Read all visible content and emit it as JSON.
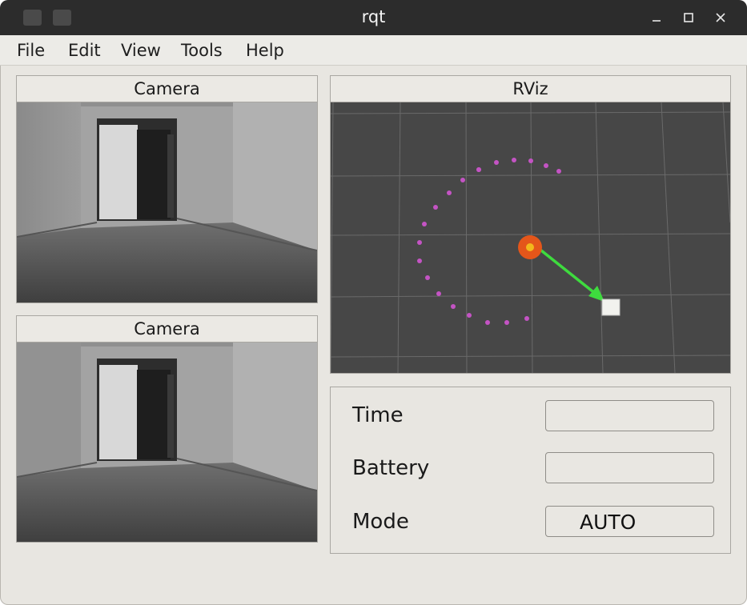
{
  "window": {
    "title": "rqt"
  },
  "menu": [
    "File",
    "Edit",
    "View",
    "Tools",
    "Help"
  ],
  "panels": {
    "camera_top": {
      "title": "Camera"
    },
    "camera_bottom": {
      "title": "Camera"
    },
    "rviz": {
      "title": "RViz"
    }
  },
  "status": {
    "time_label": "Time",
    "time_value": "",
    "battery_label": "Battery",
    "battery_value": "",
    "mode_label": "Mode",
    "mode_value": "AUTO"
  },
  "colors": {
    "path_dots": "#c454c4",
    "robot_outer": "#e4561a",
    "robot_inner": "#f2b81c",
    "goal_arrow": "#3edb3e",
    "rviz_background": "#474747"
  },
  "icons": [
    "minimize-icon",
    "maximize-icon",
    "close-icon"
  ]
}
